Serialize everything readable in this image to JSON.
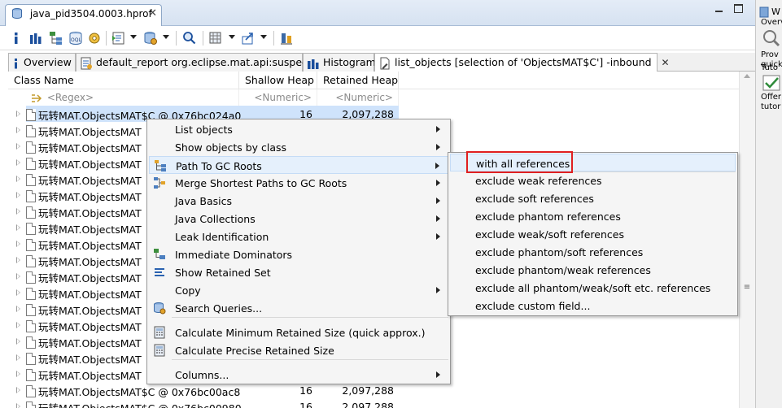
{
  "editor": {
    "tab_title": "java_pid3504.0003.hprof"
  },
  "toolbar": {
    "icons": [
      "info-icon",
      "histogram-icon",
      "dominator-tree-icon",
      "oql-icon",
      "thread-overview-icon",
      "run-report-icon",
      "query-browser-icon",
      "search-icon",
      "heap-dump-overview-icon",
      "export-icon",
      "pin-icon"
    ]
  },
  "inner_tabs": [
    {
      "label": "Overview"
    },
    {
      "label": "default_report  org.eclipse.mat.api:suspects"
    },
    {
      "label": "Histogram"
    },
    {
      "label": "list_objects [selection of 'ObjectsMAT$C'] -inbound"
    }
  ],
  "table": {
    "columns": [
      "Class Name",
      "Shallow Heap",
      "Retained Heap"
    ],
    "filter": {
      "name": "<Regex>",
      "shallow": "<Numeric>",
      "retained": "<Numeric>"
    },
    "rows": [
      {
        "name": "玩转MAT.ObjectsMAT$C @ 0x76bc024a0",
        "shallow": "16",
        "retained": "2,097,288",
        "selected": true
      },
      {
        "name": "玩转MAT.ObjectsMAT",
        "shallow": "",
        "retained": ""
      },
      {
        "name": "玩转MAT.ObjectsMAT",
        "shallow": "",
        "retained": ""
      },
      {
        "name": "玩转MAT.ObjectsMAT",
        "shallow": "",
        "retained": ""
      },
      {
        "name": "玩转MAT.ObjectsMAT",
        "shallow": "",
        "retained": ""
      },
      {
        "name": "玩转MAT.ObjectsMAT",
        "shallow": "",
        "retained": ""
      },
      {
        "name": "玩转MAT.ObjectsMAT",
        "shallow": "",
        "retained": ""
      },
      {
        "name": "玩转MAT.ObjectsMAT",
        "shallow": "",
        "retained": ""
      },
      {
        "name": "玩转MAT.ObjectsMAT",
        "shallow": "",
        "retained": ""
      },
      {
        "name": "玩转MAT.ObjectsMAT",
        "shallow": "",
        "retained": ""
      },
      {
        "name": "玩转MAT.ObjectsMAT",
        "shallow": "",
        "retained": ""
      },
      {
        "name": "玩转MAT.ObjectsMAT",
        "shallow": "",
        "retained": ""
      },
      {
        "name": "玩转MAT.ObjectsMAT",
        "shallow": "",
        "retained": ""
      },
      {
        "name": "玩转MAT.ObjectsMAT",
        "shallow": "",
        "retained": ""
      },
      {
        "name": "玩转MAT.ObjectsMAT",
        "shallow": "",
        "retained": ""
      },
      {
        "name": "玩转MAT.ObjectsMAT",
        "shallow": "",
        "retained": ""
      },
      {
        "name": "玩转MAT.ObjectsMAT",
        "shallow": "",
        "retained": ""
      },
      {
        "name": "玩转MAT.ObjectsMAT$C @ 0x76bc00ac8",
        "shallow": "16",
        "retained": "2,097,288"
      },
      {
        "name": "玩转MAT.ObjectsMAT$C @ 0x76bc00980",
        "shallow": "16",
        "retained": "2,097,288"
      }
    ]
  },
  "context_menu": {
    "items": [
      {
        "label": "List objects",
        "submenu": true,
        "icon": ""
      },
      {
        "label": "Show objects by class",
        "submenu": true,
        "icon": ""
      },
      {
        "label": "Path To GC Roots",
        "submenu": true,
        "icon": "path-to-gc-roots-icon",
        "hover": true
      },
      {
        "label": "Merge Shortest Paths to GC Roots",
        "submenu": true,
        "icon": "merge-paths-icon"
      },
      {
        "label": "Java Basics",
        "submenu": true,
        "icon": ""
      },
      {
        "label": "Java Collections",
        "submenu": true,
        "icon": ""
      },
      {
        "label": "Leak Identification",
        "submenu": true,
        "icon": ""
      },
      {
        "label": "Immediate Dominators",
        "submenu": false,
        "icon": "immediate-dominators-icon"
      },
      {
        "label": "Show Retained Set",
        "submenu": false,
        "icon": "retained-set-icon"
      },
      {
        "label": "Copy",
        "submenu": true,
        "icon": ""
      },
      {
        "label": "Search Queries...",
        "submenu": false,
        "icon": "search-queries-icon"
      },
      {
        "label": "Calculate Minimum Retained Size (quick approx.)",
        "submenu": false,
        "icon": "calculator-icon"
      },
      {
        "label": "Calculate Precise Retained Size",
        "submenu": false,
        "icon": "calculator-icon"
      },
      {
        "label": "Columns...",
        "submenu": true,
        "icon": ""
      }
    ]
  },
  "sub_menu": {
    "items": [
      {
        "label": "with all references",
        "hover": true
      },
      {
        "label": "exclude weak references"
      },
      {
        "label": "exclude soft references"
      },
      {
        "label": "exclude phantom references"
      },
      {
        "label": "exclude weak/soft references"
      },
      {
        "label": "exclude phantom/soft references"
      },
      {
        "label": "exclude phantom/weak references"
      },
      {
        "label": "exclude all phantom/weak/soft etc. references"
      },
      {
        "label": "exclude custom field..."
      }
    ]
  },
  "right_pane": {
    "labels": [
      "W",
      "Overv",
      "Prov",
      "quick",
      "Tuto",
      "Offer",
      "tutor"
    ]
  },
  "colors": {
    "selection": "#cfe3fb",
    "menu_hover": "#e5f0fc",
    "highlight_box": "#e02020"
  }
}
